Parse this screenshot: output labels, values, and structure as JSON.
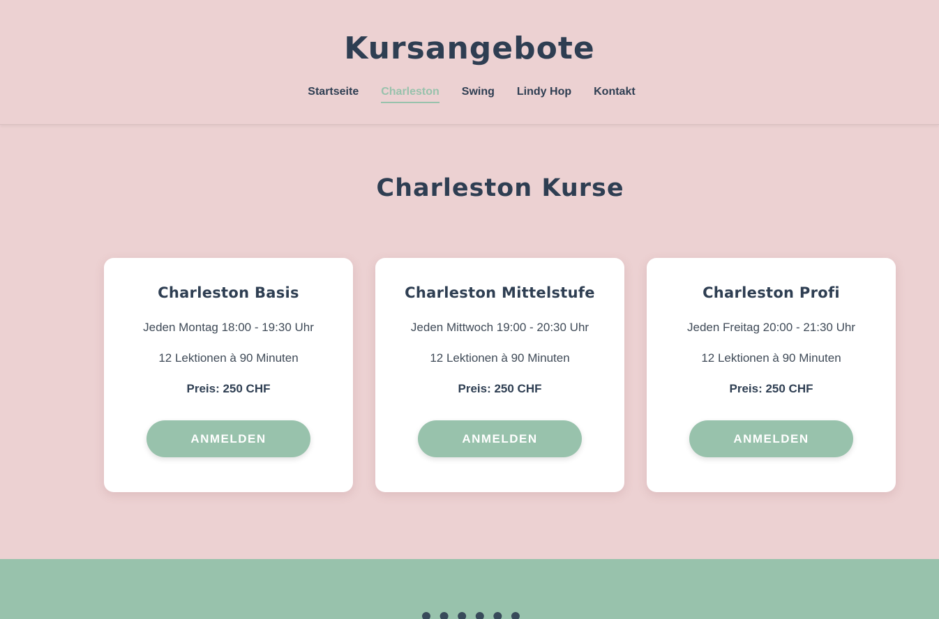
{
  "header": {
    "title": "Kursangebote",
    "nav": [
      {
        "label": "Startseite",
        "active": false
      },
      {
        "label": "Charleston",
        "active": true
      },
      {
        "label": "Swing",
        "active": false
      },
      {
        "label": "Lindy Hop",
        "active": false
      },
      {
        "label": "Kontakt",
        "active": false
      }
    ]
  },
  "main": {
    "section_title": "Charleston Kurse",
    "courses": [
      {
        "title": "Charleston Basis",
        "schedule": "Jeden Montag 18:00 - 19:30 Uhr",
        "lessons": "12 Lektionen à 90 Minuten",
        "price": "Preis: 250 CHF",
        "button": "ANMELDEN"
      },
      {
        "title": "Charleston Mittelstufe",
        "schedule": "Jeden Mittwoch 19:00 - 20:30 Uhr",
        "lessons": "12 Lektionen à 90 Minuten",
        "price": "Preis: 250 CHF",
        "button": "ANMELDEN"
      },
      {
        "title": "Charleston Profi",
        "schedule": "Jeden Freitag 20:00 - 21:30 Uhr",
        "lessons": "12 Lektionen à 90 Minuten",
        "price": "Preis: 250 CHF",
        "button": "ANMELDEN"
      }
    ]
  },
  "colors": {
    "background": "#ecd1d2",
    "accent": "#98c2ac",
    "text": "#2e3e52",
    "card": "#ffffff"
  }
}
